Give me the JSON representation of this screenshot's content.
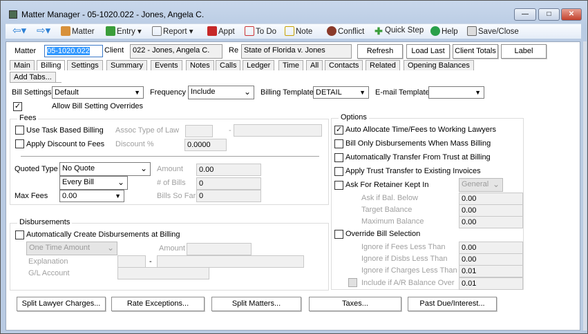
{
  "window": {
    "title": "Matter Manager - 05-1020.022 - Jones, Angela C."
  },
  "toolbar": {
    "matter": "Matter",
    "entry": "Entry",
    "report": "Report",
    "appt": "Appt",
    "todo": "To Do",
    "note": "Note",
    "conflict": "Conflict",
    "quick_step": "Quick Step",
    "help": "Help",
    "save_close": "Save/Close"
  },
  "header": {
    "matter_label": "Matter",
    "matter_value": "05-1020.022",
    "client_label": "Client",
    "client_value": "022 - Jones, Angela C.",
    "re_label": "Re",
    "re_value": "State of Florida v. Jones",
    "refresh": "Refresh",
    "load_last": "Load Last",
    "client_totals": "Client Totals",
    "label": "Label"
  },
  "tabs": [
    "Main",
    "Billing",
    "Settings",
    "Summary",
    "Events",
    "Notes",
    "Calls",
    "Ledger",
    "Time",
    "All",
    "Contacts",
    "Related",
    "Opening Balances"
  ],
  "add_tabs": "Add Tabs...",
  "billing": {
    "bill_settings_label": "Bill Settings",
    "bill_settings": "Default",
    "frequency_label": "Frequency",
    "frequency": "Include",
    "billing_template_label": "Billing Template",
    "billing_template": "DETAIL",
    "email_template_label": "E-mail Template",
    "email_template": "",
    "allow_overrides": "Allow Bill Setting Overrides"
  },
  "fees": {
    "title": "Fees",
    "task_based": "Use Task Based Billing",
    "assoc_type": "Assoc Type of Law",
    "dash": "-",
    "apply_discount": "Apply Discount to Fees",
    "discount_label": "Discount %",
    "discount": "0.0000",
    "quoted_type_label": "Quoted Type",
    "quoted_type": "No Quote",
    "every_bill": "Every Bill",
    "amount_label": "Amount",
    "amount": "0.00",
    "bills_label": "# of Bills",
    "bills": "0",
    "bills_so_far_label": "Bills So Far",
    "bills_so_far": "0",
    "max_fees_label": "Max Fees",
    "max_fees": "0.00"
  },
  "disb": {
    "title": "Disbursements",
    "auto_create": "Automatically Create Disbursements at Billing",
    "type": "One Time Amount",
    "amount_label": "Amount",
    "explanation_label": "Explanation",
    "dash": "-",
    "gl_label": "G/L Account"
  },
  "options": {
    "title": "Options",
    "auto_allocate": "Auto Allocate Time/Fees to Working Lawyers",
    "bill_only_disb": "Bill Only Disbursements When Mass Billing",
    "auto_transfer": "Automatically Transfer From Trust at Billing",
    "apply_trust": "Apply Trust Transfer to Existing Invoices",
    "ask_retainer": "Ask For Retainer Kept In",
    "retainer_account": "General",
    "ask_below_label": "Ask if Bal. Below",
    "ask_below": "0.00",
    "target_label": "Target Balance",
    "target": "0.00",
    "max_label": "Maximum Balance",
    "max": "0.00",
    "override_sel": "Override Bill Selection",
    "ign_fees_label": "Ignore if Fees Less Than",
    "ign_fees": "0.00",
    "ign_disbs_label": "Ignore if Disbs Less Than",
    "ign_disbs": "0.00",
    "ign_charges_label": "Ignore if Charges Less Than",
    "ign_charges": "0.01",
    "include_ar_label": "Include if A/R Balance Over",
    "include_ar": "0.01"
  },
  "buttons": {
    "split_lawyer": "Split Lawyer Charges...",
    "rate_exceptions": "Rate Exceptions...",
    "split_matters": "Split Matters...",
    "taxes": "Taxes...",
    "past_due": "Past Due/Interest..."
  },
  "checks": {
    "allow_overrides": true,
    "auto_allocate": true
  },
  "check_mark": "✓"
}
